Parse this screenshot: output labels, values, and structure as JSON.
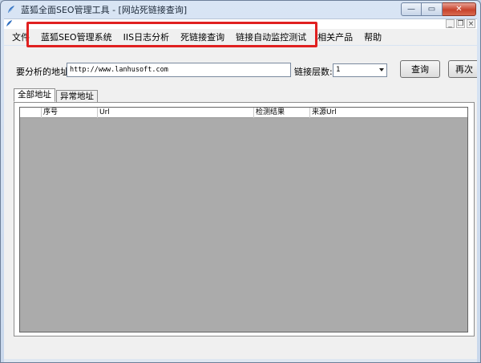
{
  "window": {
    "title": "蓝狐全面SEO管理工具 - [网站死链接查询]",
    "controls": {
      "minimize": "—",
      "maximize": "▭",
      "close": "✕"
    },
    "mdi_controls": {
      "minimize": "_",
      "restore": "❐",
      "close": "×"
    }
  },
  "menu": {
    "items": [
      {
        "label": "文件"
      },
      {
        "label": "蓝狐SEO管理系统"
      },
      {
        "label": "IIS日志分析"
      },
      {
        "label": "死链接查询"
      },
      {
        "label": "链接自动监控测试"
      },
      {
        "label": "相关产品"
      },
      {
        "label": "帮助"
      }
    ]
  },
  "form": {
    "url_label": "要分析的地址:",
    "url_value": "http://www.lanhusoft.com",
    "depth_label": "链接层数:",
    "depth_value": "1",
    "query_button": "查询",
    "retry_button": "再次"
  },
  "tabs": [
    {
      "label": "全部地址",
      "active": true
    },
    {
      "label": "异常地址",
      "active": false
    }
  ],
  "grid": {
    "columns": [
      "序号",
      "Url",
      "检测结果",
      "来源Url"
    ]
  },
  "colors": {
    "highlight": "#e02020",
    "grid_empty": "#ababab"
  }
}
